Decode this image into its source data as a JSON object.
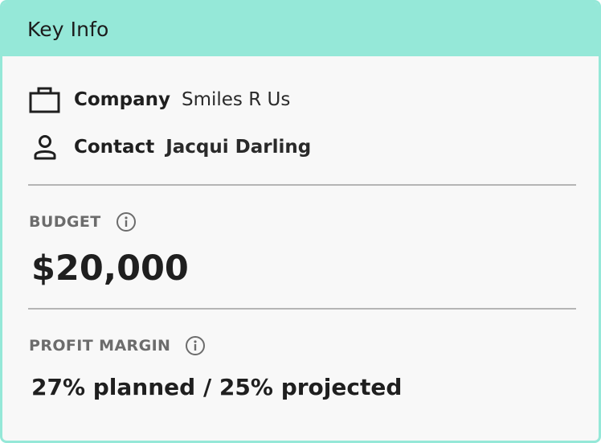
{
  "card": {
    "title": "Key Info"
  },
  "company": {
    "icon": "briefcase-icon",
    "label": "Company",
    "value": "Smiles R Us"
  },
  "contact": {
    "icon": "person-icon",
    "label": "Contact",
    "value": "Jacqui Darling"
  },
  "budget": {
    "label": "BUDGET",
    "info_icon": "info-icon",
    "value": "$20,000"
  },
  "profit_margin": {
    "label": "PROFIT MARGIN",
    "info_icon": "info-icon",
    "value": "27% planned / 25% projected"
  },
  "colors": {
    "header_accent": "#95e8d8",
    "card_background": "#f8f8f8",
    "section_label": "#6c6c6c"
  }
}
